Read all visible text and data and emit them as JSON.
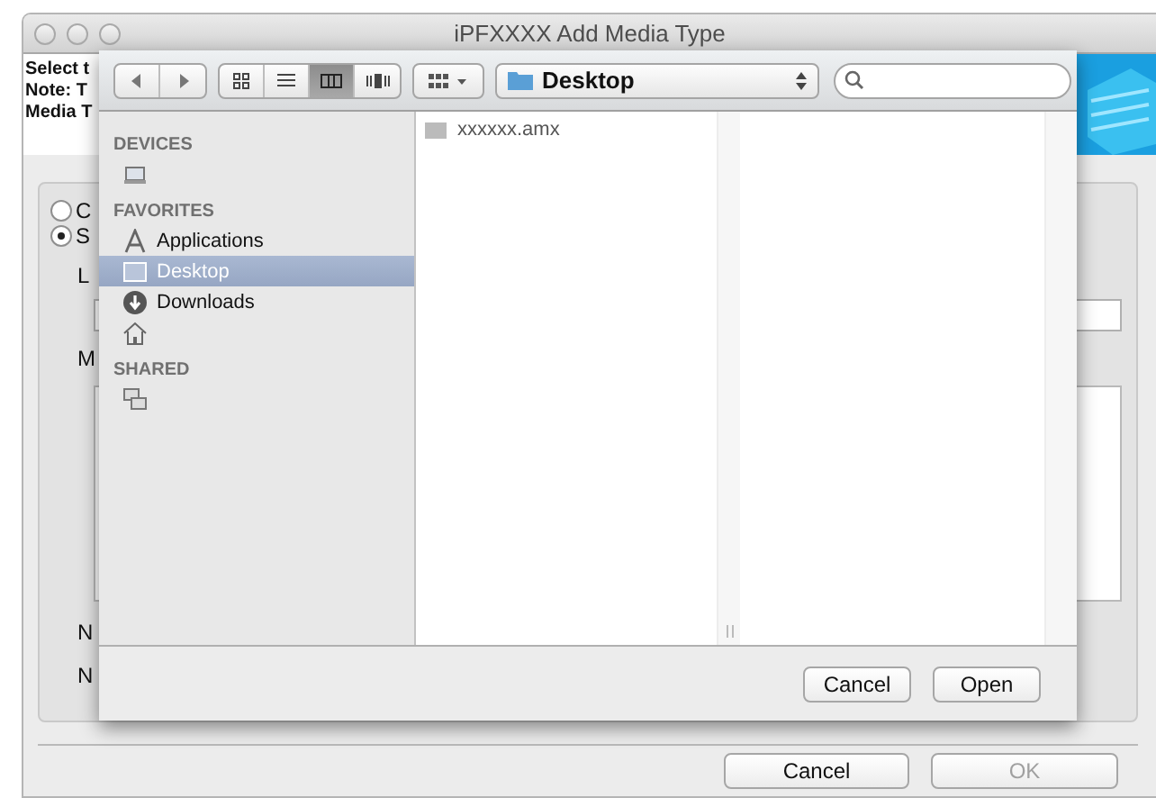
{
  "window": {
    "title": "iPFXXXX Add Media Type",
    "description_lines": [
      "Select t",
      "Note: T",
      "Media T"
    ],
    "options": [
      {
        "label": "C",
        "selected": false
      },
      {
        "label": "S",
        "selected": true
      }
    ],
    "field_label": "L",
    "list_label": "M",
    "counts": [
      "N",
      "N"
    ],
    "buttons": [
      {
        "label": "Cancel",
        "disabled": false
      },
      {
        "label": "OK",
        "disabled": true
      }
    ]
  },
  "sheet": {
    "view_buttons": [
      {
        "kind": "icons",
        "selected": false
      },
      {
        "kind": "list",
        "selected": false
      },
      {
        "kind": "columns",
        "selected": true
      },
      {
        "kind": "coverflow",
        "selected": false
      }
    ],
    "location": "Desktop",
    "sidebar": [
      {
        "heading": "DEVICES",
        "items": [
          {
            "kind": "computer",
            "selected": false
          }
        ]
      },
      {
        "heading": "FAVORITES",
        "items": [
          {
            "kind": "applications",
            "label": "Applications",
            "selected": false
          },
          {
            "kind": "desktop",
            "label": "Desktop",
            "selected": true
          },
          {
            "kind": "downloads",
            "label": "Downloads",
            "selected": false
          },
          {
            "kind": "home",
            "selected": false
          }
        ]
      },
      {
        "heading": "SHARED",
        "items": [
          {
            "kind": "network",
            "selected": false
          }
        ]
      }
    ],
    "files": [
      "xxxxxx.amx"
    ],
    "buttons": [
      {
        "label": "Cancel",
        "disabled": false
      },
      {
        "label": "Open",
        "disabled": false
      }
    ]
  }
}
